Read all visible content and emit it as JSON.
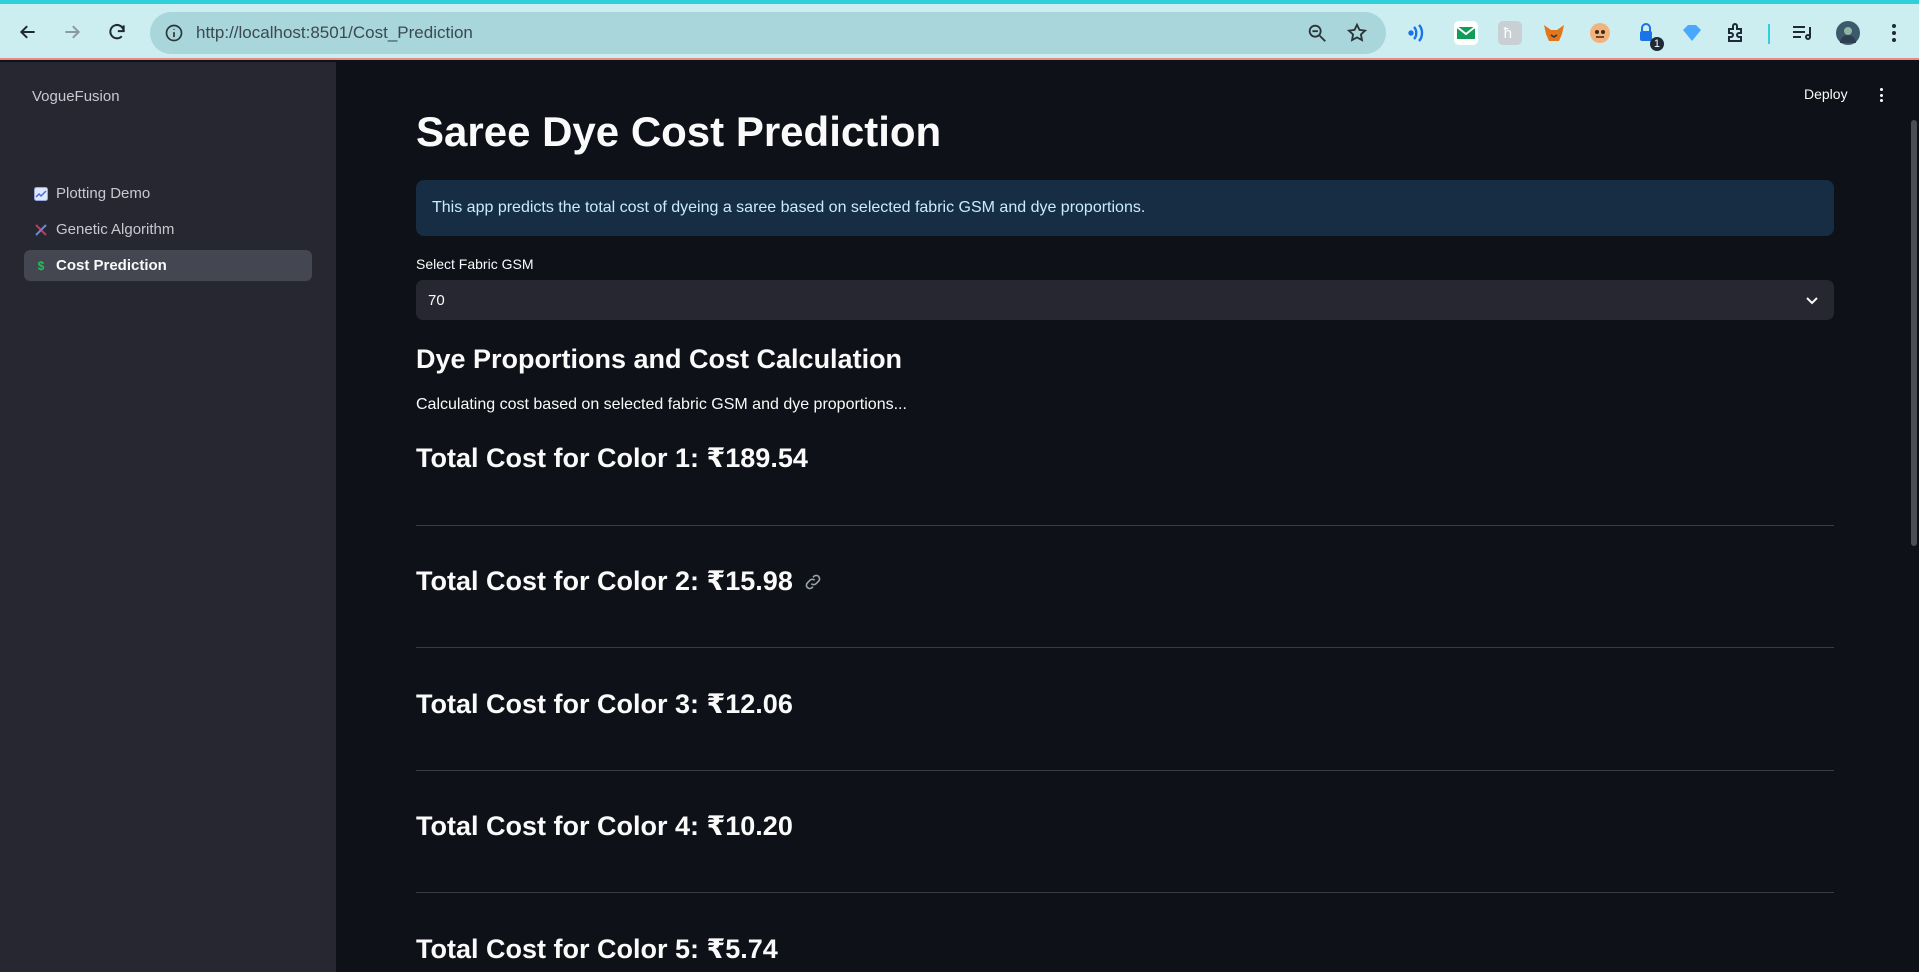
{
  "browser": {
    "url": "http://localhost:8501/Cost_Prediction",
    "ext_badge": "1"
  },
  "sidebar": {
    "app_name": "VogueFusion",
    "items": [
      {
        "label": "Plotting Demo",
        "icon": "chart-icon"
      },
      {
        "label": "Genetic Algorithm",
        "icon": "dna-icon"
      },
      {
        "label": "Cost Prediction",
        "icon": "dollar-icon",
        "active": true
      }
    ]
  },
  "header": {
    "deploy_label": "Deploy"
  },
  "main": {
    "title": "Saree Dye Cost Prediction",
    "info": "This app predicts the total cost of dyeing a saree based on selected fabric GSM and dye proportions.",
    "gsm_label": "Select Fabric GSM",
    "gsm_value": "70",
    "subheader": "Dye Proportions and Cost Calculation",
    "note": "Calculating cost based on selected fabric GSM and dye proportions...",
    "costs": [
      "Total Cost for Color 1: ₹189.54",
      "Total Cost for Color 2: ₹15.98",
      "Total Cost for Color 3: ₹12.06",
      "Total Cost for Color 4: ₹10.20",
      "Total Cost for Color 5: ₹5.74"
    ]
  },
  "colors": {
    "background": "#0e1117",
    "sidebar": "#262730",
    "info_bg": "#172d43",
    "browser_bar": "#cdeef0"
  }
}
